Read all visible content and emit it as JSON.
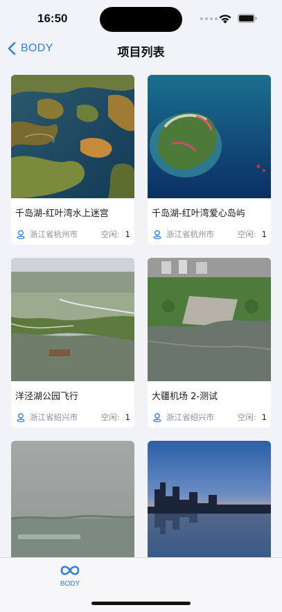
{
  "status_bar": {
    "time": "16:50"
  },
  "nav": {
    "back_label": "BODY",
    "title": "项目列表"
  },
  "projects": [
    {
      "title": "千岛湖-红叶湾水上迷宫",
      "location": "浙江省杭州市",
      "free_label": "空闲:",
      "free_count": "1",
      "image": "aerial-lake-islands"
    },
    {
      "title": "千岛湖-红叶湾爱心岛屿",
      "location": "浙江省杭州市",
      "free_label": "空闲:",
      "free_count": "1",
      "image": "aerial-heart-island"
    },
    {
      "title": "洋泾湖公园飞行",
      "location": "浙江省绍兴市",
      "free_label": "空闲:",
      "free_count": "1",
      "image": "aerial-lake-park"
    },
    {
      "title": "大疆机场 2-测试",
      "location": "浙江省绍兴市",
      "free_label": "空闲:",
      "free_count": "1",
      "image": "aerial-plaza-river"
    },
    {
      "title": "",
      "location": "",
      "free_label": "",
      "free_count": "",
      "image": "hazy-cityscape"
    },
    {
      "title": "",
      "location": "",
      "free_label": "",
      "free_count": "",
      "image": "city-skyline-sunset"
    }
  ],
  "tab_bar": {
    "items": [
      {
        "label": "BODY",
        "icon": "infinity-icon",
        "active": true
      }
    ]
  },
  "colors": {
    "accent": "#2f7ee8",
    "background": "#f2f3f7"
  }
}
